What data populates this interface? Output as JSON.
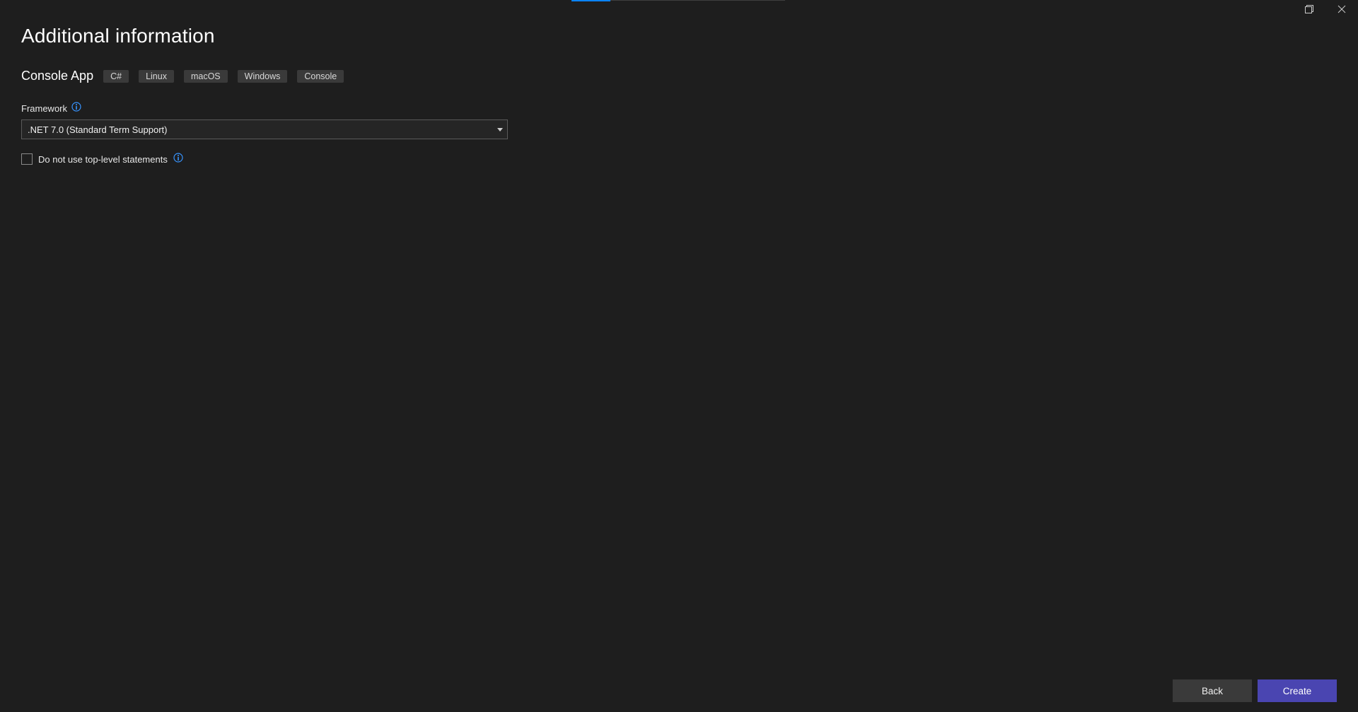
{
  "page": {
    "title": "Additional information",
    "subtitle": "Console App",
    "tags": [
      "C#",
      "Linux",
      "macOS",
      "Windows",
      "Console"
    ]
  },
  "form": {
    "framework_label": "Framework",
    "framework_value": ".NET 7.0 (Standard Term Support)",
    "checkbox_label": "Do not use top-level statements"
  },
  "footer": {
    "back_label": "Back",
    "create_label": "Create"
  }
}
